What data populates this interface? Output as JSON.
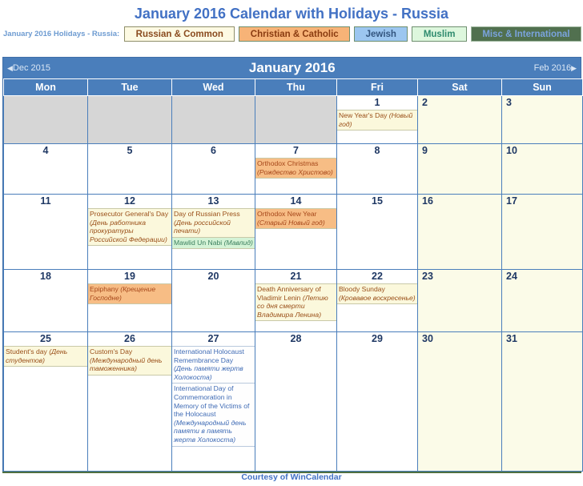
{
  "page": {
    "title": "January 2016 Calendar with Holidays - Russia",
    "footer": "Courtesy of WinCalendar"
  },
  "legend": {
    "label": "January 2016 Holidays - Russia:",
    "items": [
      {
        "key": "russian",
        "label": "Russian & Common",
        "bg": "#fdfae3",
        "fg": "#8a4b1e"
      },
      {
        "key": "christian",
        "label": "Christian & Catholic",
        "bg": "#f7b377",
        "fg": "#8a3b10"
      },
      {
        "key": "jewish",
        "label": "Jewish",
        "bg": "#9cc6f0",
        "fg": "#33557f"
      },
      {
        "key": "muslim",
        "label": "Muslim",
        "bg": "#ddf7dd",
        "fg": "#2e8b6e"
      },
      {
        "key": "misc",
        "label": "Misc & International",
        "bg": "#51704f",
        "fg": "#7aa3dd"
      }
    ]
  },
  "nav": {
    "prev": "Dec 2015",
    "next": "Feb 2016",
    "prev_arrow": "◀",
    "next_arrow": "▶",
    "month_title": "January 2016"
  },
  "weekdays": [
    {
      "label": "Mon",
      "weekend": false
    },
    {
      "label": "Tue",
      "weekend": false
    },
    {
      "label": "Wed",
      "weekend": false
    },
    {
      "label": "Thu",
      "weekend": false
    },
    {
      "label": "Fri",
      "weekend": false
    },
    {
      "label": "Sat",
      "weekend": true
    },
    {
      "label": "Sun",
      "weekend": true
    }
  ],
  "weeks": [
    [
      {
        "blank": true
      },
      {
        "blank": true
      },
      {
        "blank": true
      },
      {
        "blank": true
      },
      {
        "day": "1",
        "weekend": false,
        "events": [
          {
            "cat": "russian",
            "en": "New Year's Day",
            "ru": "(Новый год)"
          }
        ]
      },
      {
        "day": "2",
        "weekend": true,
        "events": []
      },
      {
        "day": "3",
        "weekend": true,
        "events": []
      }
    ],
    [
      {
        "day": "4",
        "weekend": false,
        "events": []
      },
      {
        "day": "5",
        "weekend": false,
        "events": []
      },
      {
        "day": "6",
        "weekend": false,
        "events": []
      },
      {
        "day": "7",
        "weekend": false,
        "events": [
          {
            "cat": "christian",
            "en": "Orthodox Christmas",
            "ru": "(Рождество Христово)"
          }
        ]
      },
      {
        "day": "8",
        "weekend": false,
        "events": []
      },
      {
        "day": "9",
        "weekend": true,
        "events": []
      },
      {
        "day": "10",
        "weekend": true,
        "events": []
      }
    ],
    [
      {
        "day": "11",
        "weekend": false,
        "events": []
      },
      {
        "day": "12",
        "weekend": false,
        "events": [
          {
            "cat": "russian",
            "en": "Prosecutor General's Day",
            "ru": "(День работника прокуратуры Российской Федерации)"
          }
        ]
      },
      {
        "day": "13",
        "weekend": false,
        "events": [
          {
            "cat": "russian",
            "en": "Day of Russian Press",
            "ru": "(День российской печати)"
          },
          {
            "cat": "muslim",
            "en": "Mawlid Un Nabi",
            "ru": "(Мавлид)"
          }
        ]
      },
      {
        "day": "14",
        "weekend": false,
        "events": [
          {
            "cat": "christian",
            "en": "Orthodox New Year",
            "ru": "(Старый Новый год)"
          }
        ]
      },
      {
        "day": "15",
        "weekend": false,
        "events": []
      },
      {
        "day": "16",
        "weekend": true,
        "events": []
      },
      {
        "day": "17",
        "weekend": true,
        "events": []
      }
    ],
    [
      {
        "day": "18",
        "weekend": false,
        "events": []
      },
      {
        "day": "19",
        "weekend": false,
        "events": [
          {
            "cat": "christian",
            "en": "Epiphany",
            "ru": "(Крещение Господне)"
          }
        ]
      },
      {
        "day": "20",
        "weekend": false,
        "events": []
      },
      {
        "day": "21",
        "weekend": false,
        "events": [
          {
            "cat": "russian",
            "en": "Death Anniversary of Vladimir Lenin",
            "ru": "(Летию со дня смерти Владимира Ленина)"
          }
        ]
      },
      {
        "day": "22",
        "weekend": false,
        "events": [
          {
            "cat": "russian",
            "en": "Bloody Sunday",
            "ru": "(Кровавое воскресенье)"
          }
        ]
      },
      {
        "day": "23",
        "weekend": true,
        "events": []
      },
      {
        "day": "24",
        "weekend": true,
        "events": []
      }
    ],
    [
      {
        "day": "25",
        "weekend": false,
        "events": [
          {
            "cat": "russian",
            "en": "Student's day",
            "ru": "(День студентов)"
          }
        ]
      },
      {
        "day": "26",
        "weekend": false,
        "events": [
          {
            "cat": "russian",
            "en": "Custom's Day",
            "ru": "(Международный день таможенника)"
          }
        ]
      },
      {
        "day": "27",
        "weekend": false,
        "events": [
          {
            "cat": "misc",
            "en": "International Holocaust Remembrance Day",
            "ru": "(День памяти жертв Холокоста)"
          },
          {
            "cat": "misc",
            "en": "International Day of Commemoration in Memory of the Victims of the Holocaust",
            "ru": "(Международный день памяти в память жертв Холокоста)"
          }
        ]
      },
      {
        "day": "28",
        "weekend": false,
        "events": []
      },
      {
        "day": "29",
        "weekend": false,
        "events": []
      },
      {
        "day": "30",
        "weekend": true,
        "events": []
      },
      {
        "day": "31",
        "weekend": true,
        "events": []
      }
    ]
  ]
}
